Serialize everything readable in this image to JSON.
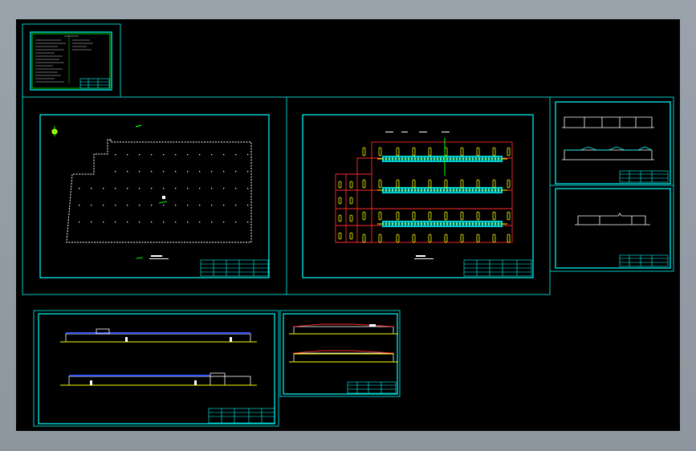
{
  "colors": {
    "background": "#000000",
    "frame": "#00c8c8",
    "titleblock": "#00ffff",
    "outline": "#ffffff",
    "green": "#00ff00",
    "red": "#ff2a2a",
    "yellow": "#ffff00",
    "blue": "#3b5bff"
  },
  "sheets": [
    {
      "id": "notes-sheet"
    },
    {
      "id": "site-plan-sheet"
    },
    {
      "id": "floor-plan-sheet"
    },
    {
      "id": "sections-sheet-a"
    },
    {
      "id": "sections-sheet-b"
    },
    {
      "id": "elevations-sheet-long"
    },
    {
      "id": "elevations-sheet-short"
    }
  ]
}
